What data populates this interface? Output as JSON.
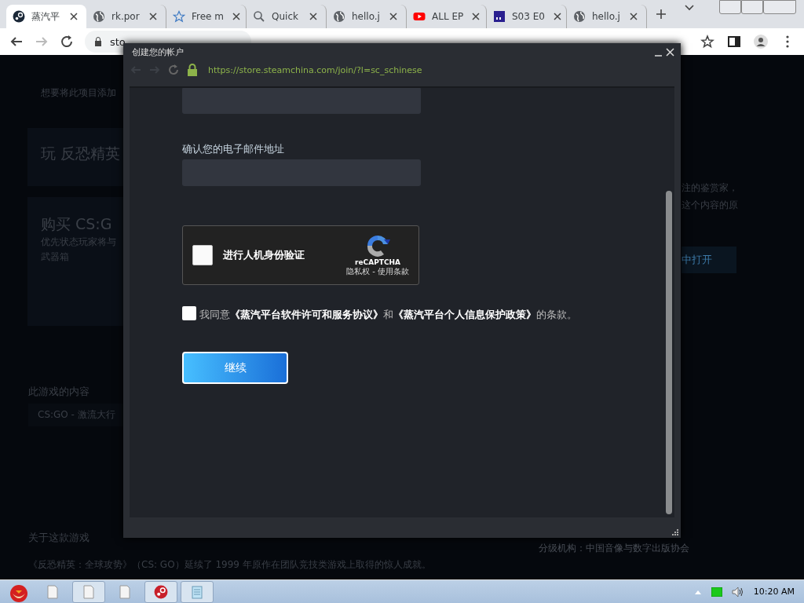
{
  "browser": {
    "tabs": [
      {
        "label": "蒸汽平",
        "kind": "steam",
        "selected": true
      },
      {
        "label": "rk.por",
        "kind": "globe",
        "selected": false
      },
      {
        "label": "Free m",
        "kind": "star",
        "selected": false
      },
      {
        "label": "Quick",
        "kind": "search",
        "selected": false
      },
      {
        "label": "hello.j",
        "kind": "globe",
        "selected": false
      },
      {
        "label": "ALL EP",
        "kind": "video",
        "selected": false
      },
      {
        "label": "S03 E0",
        "kind": "square",
        "selected": false
      },
      {
        "label": "hello.j",
        "kind": "globe",
        "selected": false
      }
    ],
    "address": "sto"
  },
  "page": {
    "wishlist_note": "想要将此项目添加",
    "play_title": "玩 反恐精英",
    "buy_title": "购买 CS:G",
    "buy_lines": [
      "优先状态玩家将与",
      "武器箱"
    ],
    "content_heading": "此游戏的内容",
    "content_item": "CS:GO - 激流大行",
    "curator_lines": [
      "注的鉴赏家，",
      "这个内容的原"
    ],
    "open_button": "中打开",
    "about_heading": "关于这款游戏",
    "rating": "分级机构：中国音像与数字出版协会",
    "description": "《反恐精英：全球攻势》（CS: GO）延续了 1999 年原作在团队竞技类游戏上取得的惊人成就。"
  },
  "popup": {
    "title": "创建您的帐户",
    "url": "https://store.steamchina.com/join/?l=sc_schinese",
    "confirm_email_label": "确认您的电子邮件地址",
    "captcha": {
      "checked": false,
      "label": "进行人机身份验证",
      "brand": "reCAPTCHA",
      "links": "隐私权 - 使用条款"
    },
    "agree": {
      "checked": false,
      "text": "我同意**《蒸汽平台软件许可和服务协议》**和**《蒸汽平台个人信息保护政策》**的条款。"
    },
    "continue_button": "继续"
  },
  "taskbar": {
    "clock": "10:20 AM"
  }
}
